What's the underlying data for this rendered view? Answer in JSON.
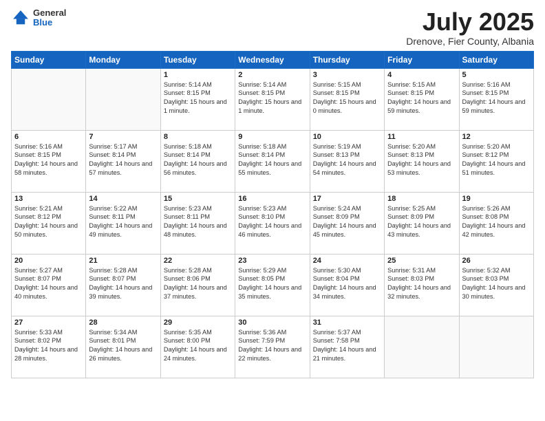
{
  "header": {
    "logo_general": "General",
    "logo_blue": "Blue",
    "main_title": "July 2025",
    "subtitle": "Drenove, Fier County, Albania"
  },
  "days_of_week": [
    "Sunday",
    "Monday",
    "Tuesday",
    "Wednesday",
    "Thursday",
    "Friday",
    "Saturday"
  ],
  "weeks": [
    [
      {
        "day": "",
        "info": ""
      },
      {
        "day": "",
        "info": ""
      },
      {
        "day": "1",
        "info": "Sunrise: 5:14 AM\nSunset: 8:15 PM\nDaylight: 15 hours and 1 minute."
      },
      {
        "day": "2",
        "info": "Sunrise: 5:14 AM\nSunset: 8:15 PM\nDaylight: 15 hours and 1 minute."
      },
      {
        "day": "3",
        "info": "Sunrise: 5:15 AM\nSunset: 8:15 PM\nDaylight: 15 hours and 0 minutes."
      },
      {
        "day": "4",
        "info": "Sunrise: 5:15 AM\nSunset: 8:15 PM\nDaylight: 14 hours and 59 minutes."
      },
      {
        "day": "5",
        "info": "Sunrise: 5:16 AM\nSunset: 8:15 PM\nDaylight: 14 hours and 59 minutes."
      }
    ],
    [
      {
        "day": "6",
        "info": "Sunrise: 5:16 AM\nSunset: 8:15 PM\nDaylight: 14 hours and 58 minutes."
      },
      {
        "day": "7",
        "info": "Sunrise: 5:17 AM\nSunset: 8:14 PM\nDaylight: 14 hours and 57 minutes."
      },
      {
        "day": "8",
        "info": "Sunrise: 5:18 AM\nSunset: 8:14 PM\nDaylight: 14 hours and 56 minutes."
      },
      {
        "day": "9",
        "info": "Sunrise: 5:18 AM\nSunset: 8:14 PM\nDaylight: 14 hours and 55 minutes."
      },
      {
        "day": "10",
        "info": "Sunrise: 5:19 AM\nSunset: 8:13 PM\nDaylight: 14 hours and 54 minutes."
      },
      {
        "day": "11",
        "info": "Sunrise: 5:20 AM\nSunset: 8:13 PM\nDaylight: 14 hours and 53 minutes."
      },
      {
        "day": "12",
        "info": "Sunrise: 5:20 AM\nSunset: 8:12 PM\nDaylight: 14 hours and 51 minutes."
      }
    ],
    [
      {
        "day": "13",
        "info": "Sunrise: 5:21 AM\nSunset: 8:12 PM\nDaylight: 14 hours and 50 minutes."
      },
      {
        "day": "14",
        "info": "Sunrise: 5:22 AM\nSunset: 8:11 PM\nDaylight: 14 hours and 49 minutes."
      },
      {
        "day": "15",
        "info": "Sunrise: 5:23 AM\nSunset: 8:11 PM\nDaylight: 14 hours and 48 minutes."
      },
      {
        "day": "16",
        "info": "Sunrise: 5:23 AM\nSunset: 8:10 PM\nDaylight: 14 hours and 46 minutes."
      },
      {
        "day": "17",
        "info": "Sunrise: 5:24 AM\nSunset: 8:09 PM\nDaylight: 14 hours and 45 minutes."
      },
      {
        "day": "18",
        "info": "Sunrise: 5:25 AM\nSunset: 8:09 PM\nDaylight: 14 hours and 43 minutes."
      },
      {
        "day": "19",
        "info": "Sunrise: 5:26 AM\nSunset: 8:08 PM\nDaylight: 14 hours and 42 minutes."
      }
    ],
    [
      {
        "day": "20",
        "info": "Sunrise: 5:27 AM\nSunset: 8:07 PM\nDaylight: 14 hours and 40 minutes."
      },
      {
        "day": "21",
        "info": "Sunrise: 5:28 AM\nSunset: 8:07 PM\nDaylight: 14 hours and 39 minutes."
      },
      {
        "day": "22",
        "info": "Sunrise: 5:28 AM\nSunset: 8:06 PM\nDaylight: 14 hours and 37 minutes."
      },
      {
        "day": "23",
        "info": "Sunrise: 5:29 AM\nSunset: 8:05 PM\nDaylight: 14 hours and 35 minutes."
      },
      {
        "day": "24",
        "info": "Sunrise: 5:30 AM\nSunset: 8:04 PM\nDaylight: 14 hours and 34 minutes."
      },
      {
        "day": "25",
        "info": "Sunrise: 5:31 AM\nSunset: 8:03 PM\nDaylight: 14 hours and 32 minutes."
      },
      {
        "day": "26",
        "info": "Sunrise: 5:32 AM\nSunset: 8:03 PM\nDaylight: 14 hours and 30 minutes."
      }
    ],
    [
      {
        "day": "27",
        "info": "Sunrise: 5:33 AM\nSunset: 8:02 PM\nDaylight: 14 hours and 28 minutes."
      },
      {
        "day": "28",
        "info": "Sunrise: 5:34 AM\nSunset: 8:01 PM\nDaylight: 14 hours and 26 minutes."
      },
      {
        "day": "29",
        "info": "Sunrise: 5:35 AM\nSunset: 8:00 PM\nDaylight: 14 hours and 24 minutes."
      },
      {
        "day": "30",
        "info": "Sunrise: 5:36 AM\nSunset: 7:59 PM\nDaylight: 14 hours and 22 minutes."
      },
      {
        "day": "31",
        "info": "Sunrise: 5:37 AM\nSunset: 7:58 PM\nDaylight: 14 hours and 21 minutes."
      },
      {
        "day": "",
        "info": ""
      },
      {
        "day": "",
        "info": ""
      }
    ]
  ]
}
